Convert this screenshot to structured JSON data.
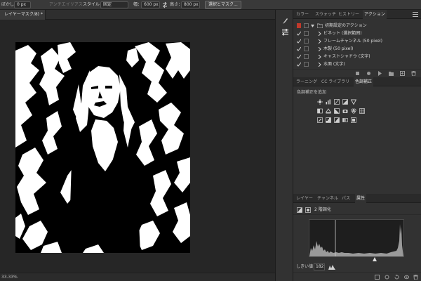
{
  "options_bar": {
    "feather_label": "ぼかし：",
    "feather_value": "0 px",
    "antialias_label": "アンチエイリアス",
    "style_label": "スタイル：",
    "style_value": "固定",
    "width_label": "幅：",
    "width_value": "600 px",
    "height_label": "高さ：",
    "height_value": "800 px",
    "select_mask_button": "選択とマスク..."
  },
  "document": {
    "tab_title": "レイヤーマスク/8) *"
  },
  "canvas_footer": {
    "zoom_text": "33.33%"
  },
  "actions_panel": {
    "tabs": [
      "カラー",
      "スウォッチ",
      "ヒストリー",
      "アクション"
    ],
    "active_tab": "アクション",
    "set_name": "初期設定のアクション",
    "actions": [
      "ビネット (選択範囲)",
      "フレームチャンネル (50 pixel)",
      "木製 (50 pixel)",
      "キャストシャドウ (文字)",
      "水面 (文字)"
    ]
  },
  "adjustments_panel": {
    "tabs": [
      "ラーニング",
      "CC ライブラリ",
      "色調補正"
    ],
    "active_tab": "色調補正",
    "title": "色調補正を追加"
  },
  "properties_panel": {
    "tabs": [
      "レイヤー",
      "チャンネル",
      "パス",
      "属性"
    ],
    "active_tab": "属性",
    "adjustment_name": "2 階調化",
    "threshold_label": "しきい値：",
    "threshold_value": "182"
  },
  "colors": {
    "accent_red": "#c0392b",
    "panel_bg": "#323232",
    "canvas_bg": "#262626"
  },
  "icons": {
    "tool_1": "brush-icon",
    "tool_2": "sliders-icon"
  }
}
